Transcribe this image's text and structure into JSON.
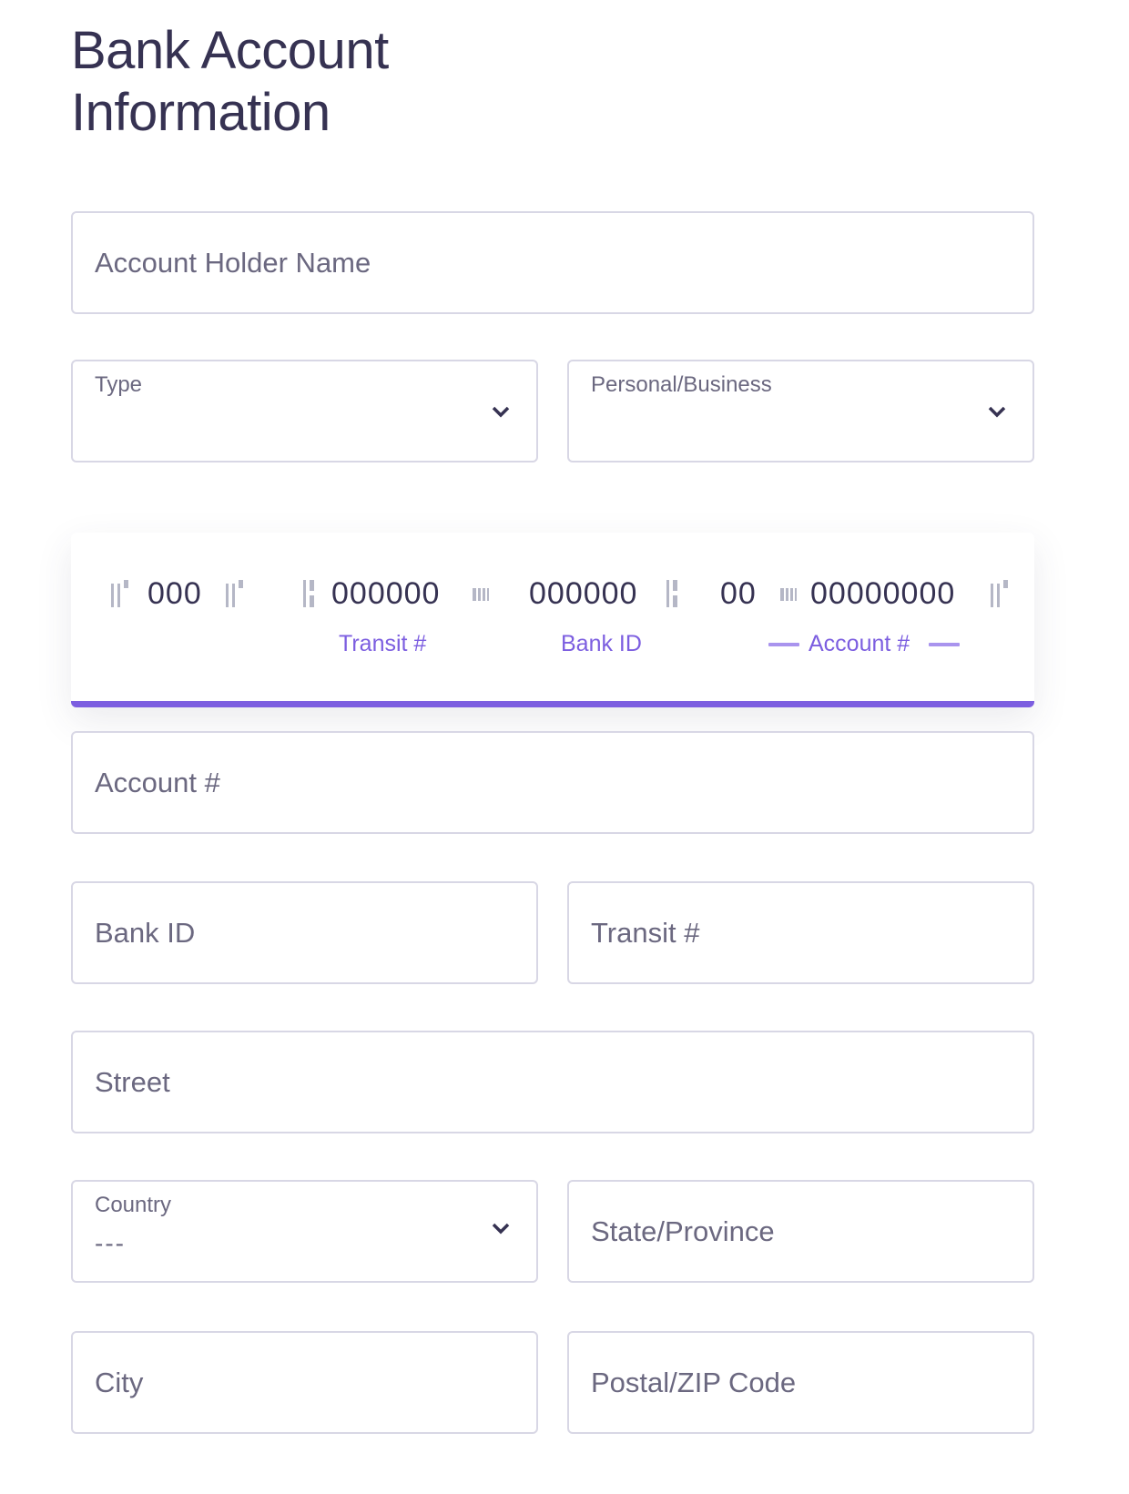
{
  "page": {
    "title": "Bank Account Information"
  },
  "form": {
    "account_holder_name": {
      "placeholder": "Account Holder Name",
      "value": ""
    },
    "type": {
      "label": "Type",
      "value": ""
    },
    "personal_business": {
      "label": "Personal/Business",
      "value": ""
    },
    "account_number": {
      "placeholder": "Account #",
      "value": ""
    },
    "bank_id": {
      "placeholder": "Bank ID",
      "value": ""
    },
    "transit_number": {
      "placeholder": "Transit #",
      "value": ""
    },
    "street": {
      "placeholder": "Street",
      "value": ""
    },
    "country": {
      "label": "Country",
      "value": "---"
    },
    "state_province": {
      "placeholder": "State/Province",
      "value": ""
    },
    "city": {
      "placeholder": "City",
      "value": ""
    },
    "postal_zip": {
      "placeholder": "Postal/ZIP Code",
      "value": ""
    }
  },
  "check_diagram": {
    "cheque_number": "000",
    "transit": "000000",
    "bank_id": "000000",
    "account_prefix": "00",
    "account": "00000000",
    "labels": {
      "transit": "Transit #",
      "bank_id": "Bank ID",
      "account": "Account #"
    },
    "icons": [
      "micr-onus-symbol",
      "micr-transit-symbol",
      "micr-dash-symbol"
    ],
    "accent_color": "#7c5ee0"
  }
}
